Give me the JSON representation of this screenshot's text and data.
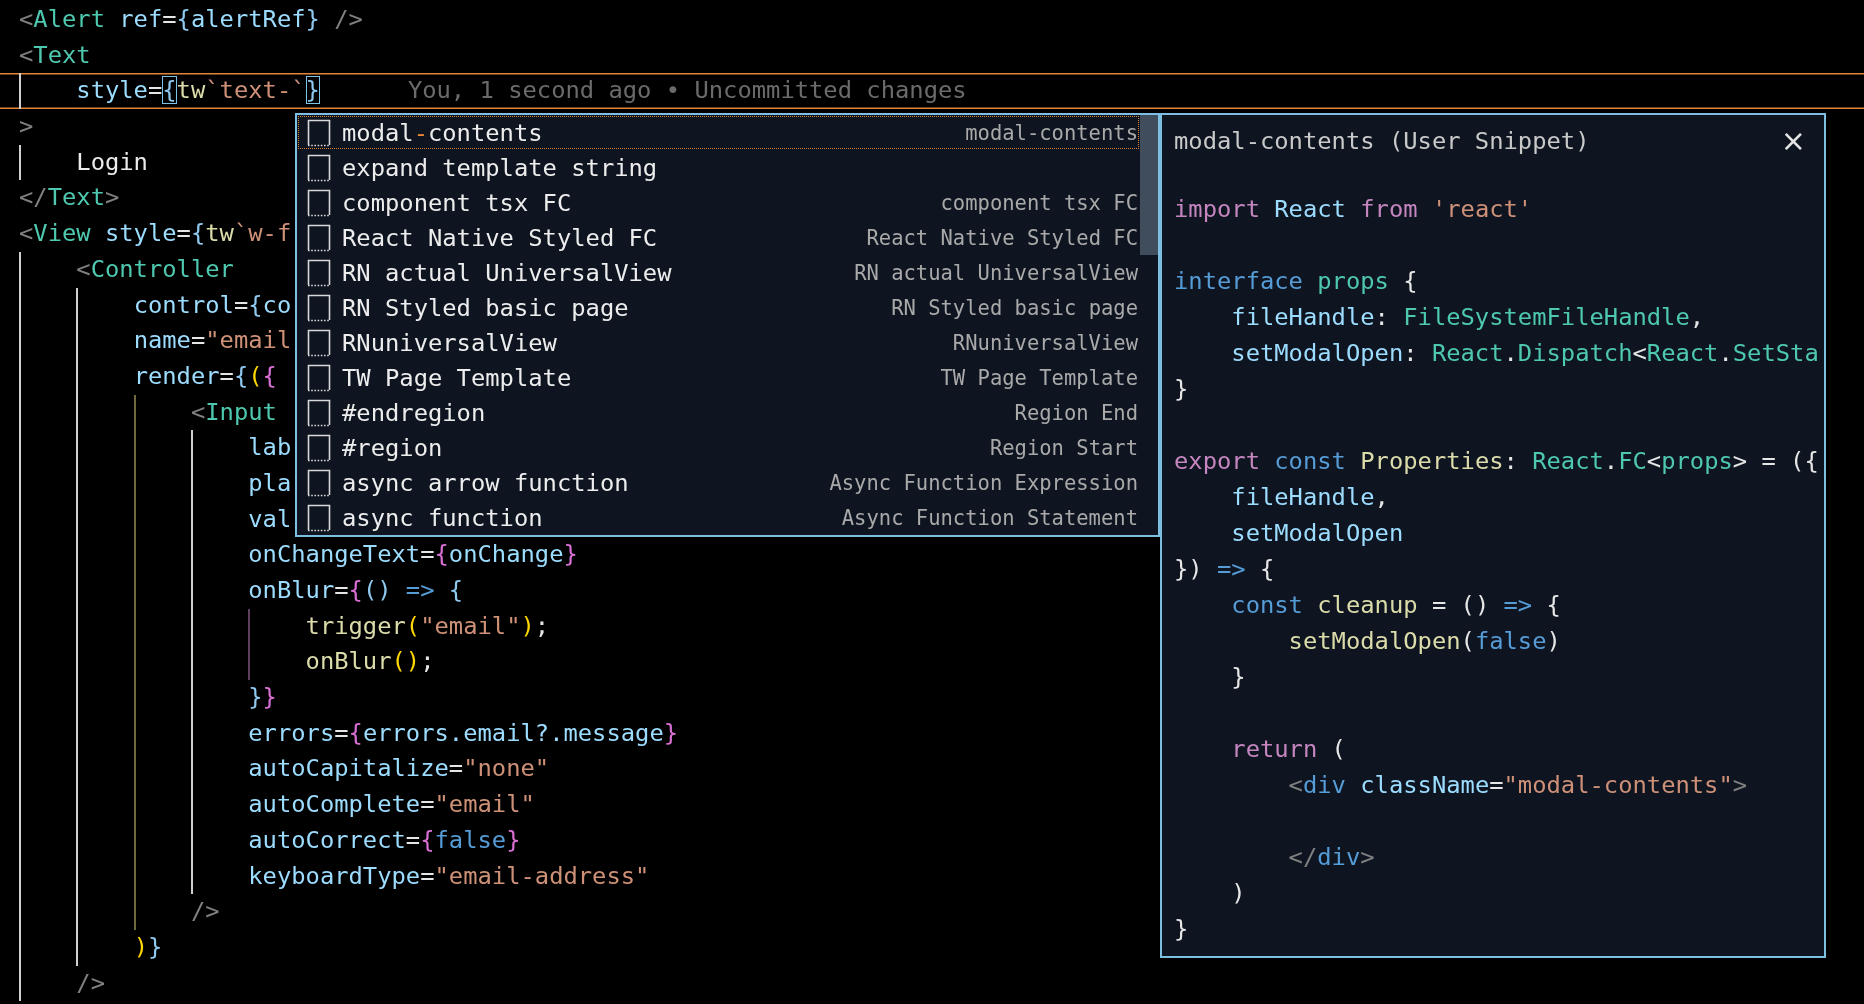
{
  "editor": {
    "lines": [
      {
        "current": false,
        "tokens": [
          {
            "t": "<",
            "kind": "p"
          },
          {
            "t": "Alert",
            "kind": "tag"
          },
          {
            "t": " ref",
            "kind": "attr"
          },
          {
            "t": "=",
            "kind": "op"
          },
          {
            "t": "{",
            "kind": "brace"
          },
          {
            "t": "alertRef",
            "kind": "var"
          },
          {
            "t": "}",
            "kind": "brace"
          },
          {
            "t": " />",
            "kind": "p"
          }
        ]
      },
      {
        "current": false,
        "tokens": [
          {
            "t": "<",
            "kind": "p"
          },
          {
            "t": "Text",
            "kind": "tag"
          }
        ]
      },
      {
        "current": true,
        "blame": "You, 1 second ago • Uncommitted changes",
        "tokens": [
          {
            "t": "    style",
            "kind": "attr"
          },
          {
            "t": "=",
            "kind": "op"
          },
          {
            "t": "{",
            "kind": "mb"
          },
          {
            "t": "tw",
            "kind": "fn"
          },
          {
            "t": "`text-`",
            "kind": "str"
          },
          {
            "t": "}",
            "kind": "mb"
          }
        ]
      },
      {
        "current": false,
        "tokens": [
          {
            "t": ">",
            "kind": "p"
          }
        ]
      },
      {
        "current": false,
        "tokens": [
          {
            "t": "    Login",
            "kind": "txt"
          }
        ]
      },
      {
        "current": false,
        "tokens": [
          {
            "t": "</",
            "kind": "p"
          },
          {
            "t": "Text",
            "kind": "tag"
          },
          {
            "t": ">",
            "kind": "p"
          }
        ]
      },
      {
        "current": false,
        "tokens": [
          {
            "t": "<",
            "kind": "p"
          },
          {
            "t": "View",
            "kind": "tag"
          },
          {
            "t": " style",
            "kind": "attr"
          },
          {
            "t": "=",
            "kind": "op"
          },
          {
            "t": "{",
            "kind": "brace"
          },
          {
            "t": "tw",
            "kind": "fn"
          },
          {
            "t": "`w-f",
            "kind": "str"
          }
        ]
      },
      {
        "current": false,
        "tokens": [
          {
            "t": "    <",
            "kind": "p"
          },
          {
            "t": "Controller",
            "kind": "tag"
          }
        ]
      },
      {
        "current": false,
        "tokens": [
          {
            "t": "        control",
            "kind": "attr"
          },
          {
            "t": "=",
            "kind": "op"
          },
          {
            "t": "{",
            "kind": "brace"
          },
          {
            "t": "co",
            "kind": "var"
          }
        ]
      },
      {
        "current": false,
        "tokens": [
          {
            "t": "        name",
            "kind": "attr"
          },
          {
            "t": "=",
            "kind": "op"
          },
          {
            "t": "\"email",
            "kind": "str"
          }
        ]
      },
      {
        "current": false,
        "tokens": [
          {
            "t": "        render",
            "kind": "attr"
          },
          {
            "t": "=",
            "kind": "op"
          },
          {
            "t": "{",
            "kind": "brace"
          },
          {
            "t": "(",
            "kind": "gold"
          },
          {
            "t": "{",
            "kind": "pink"
          }
        ]
      },
      {
        "current": false,
        "tokens": [
          {
            "t": "            <",
            "kind": "p"
          },
          {
            "t": "Input",
            "kind": "tag"
          }
        ]
      },
      {
        "current": false,
        "tokens": [
          {
            "t": "                lab",
            "kind": "attr"
          }
        ]
      },
      {
        "current": false,
        "tokens": [
          {
            "t": "                pla",
            "kind": "attr"
          }
        ]
      },
      {
        "current": false,
        "tokens": [
          {
            "t": "                val",
            "kind": "attr"
          }
        ]
      },
      {
        "current": false,
        "tokens": [
          {
            "t": "                onChangeText",
            "kind": "attr"
          },
          {
            "t": "=",
            "kind": "op"
          },
          {
            "t": "{",
            "kind": "pink"
          },
          {
            "t": "onChange",
            "kind": "var"
          },
          {
            "t": "}",
            "kind": "pink"
          }
        ]
      },
      {
        "current": false,
        "tokens": [
          {
            "t": "                onBlur",
            "kind": "attr"
          },
          {
            "t": "=",
            "kind": "op"
          },
          {
            "t": "{",
            "kind": "pink"
          },
          {
            "t": "()",
            "kind": "brace"
          },
          {
            "t": " =>",
            "kind": "kw"
          },
          {
            "t": " {",
            "kind": "brace"
          }
        ]
      },
      {
        "current": false,
        "tokens": [
          {
            "t": "                    trigger",
            "kind": "fn"
          },
          {
            "t": "(",
            "kind": "gold"
          },
          {
            "t": "\"email\"",
            "kind": "str"
          },
          {
            "t": ")",
            "kind": "gold"
          },
          {
            "t": ";",
            "kind": "op"
          }
        ]
      },
      {
        "current": false,
        "tokens": [
          {
            "t": "                    onBlur",
            "kind": "fn"
          },
          {
            "t": "()",
            "kind": "gold"
          },
          {
            "t": ";",
            "kind": "op"
          }
        ]
      },
      {
        "current": false,
        "tokens": [
          {
            "t": "                }",
            "kind": "brace"
          },
          {
            "t": "}",
            "kind": "pink"
          }
        ]
      },
      {
        "current": false,
        "tokens": [
          {
            "t": "                errors",
            "kind": "attr"
          },
          {
            "t": "=",
            "kind": "op"
          },
          {
            "t": "{",
            "kind": "pink"
          },
          {
            "t": "errors.email?.message",
            "kind": "var"
          },
          {
            "t": "}",
            "kind": "pink"
          }
        ]
      },
      {
        "current": false,
        "tokens": [
          {
            "t": "                autoCapitalize",
            "kind": "attr"
          },
          {
            "t": "=",
            "kind": "op"
          },
          {
            "t": "\"none\"",
            "kind": "str"
          }
        ]
      },
      {
        "current": false,
        "tokens": [
          {
            "t": "                autoComplete",
            "kind": "attr"
          },
          {
            "t": "=",
            "kind": "op"
          },
          {
            "t": "\"email\"",
            "kind": "str"
          }
        ]
      },
      {
        "current": false,
        "tokens": [
          {
            "t": "                autoCorrect",
            "kind": "attr"
          },
          {
            "t": "=",
            "kind": "op"
          },
          {
            "t": "{",
            "kind": "pink"
          },
          {
            "t": "false",
            "kind": "kw"
          },
          {
            "t": "}",
            "kind": "pink"
          }
        ]
      },
      {
        "current": false,
        "tokens": [
          {
            "t": "                keyboardType",
            "kind": "attr"
          },
          {
            "t": "=",
            "kind": "op"
          },
          {
            "t": "\"email-address\"",
            "kind": "str"
          }
        ]
      },
      {
        "current": false,
        "tokens": [
          {
            "t": "            />",
            "kind": "p"
          }
        ]
      },
      {
        "current": false,
        "tokens": [
          {
            "t": "        )",
            "kind": "gold"
          },
          {
            "t": "}",
            "kind": "brace"
          }
        ]
      },
      {
        "current": false,
        "tokens": [
          {
            "t": "    />",
            "kind": "p"
          }
        ]
      }
    ]
  },
  "suggest": {
    "items": [
      {
        "selected": true,
        "label_parts": [
          {
            "text": "modal",
            "match": false
          },
          {
            "text": "-",
            "match": true
          },
          {
            "text": "contents",
            "match": false
          }
        ],
        "detail": "modal-contents"
      },
      {
        "selected": false,
        "label": "expand template string"
      },
      {
        "selected": false,
        "label": "component tsx FC",
        "detail": "component tsx FC"
      },
      {
        "selected": false,
        "label": "React Native Styled FC",
        "detail": "React Native Styled FC"
      },
      {
        "selected": false,
        "label": "RN actual UniversalView",
        "detail": "RN actual UniversalView"
      },
      {
        "selected": false,
        "label": "RN Styled basic page",
        "detail": "RN Styled basic page"
      },
      {
        "selected": false,
        "label": "RNuniversalView",
        "detail": "RNuniversalView"
      },
      {
        "selected": false,
        "label": "TW Page Template",
        "detail": "TW Page Template"
      },
      {
        "selected": false,
        "label": "#endregion",
        "detail": "Region End"
      },
      {
        "selected": false,
        "label": "#region",
        "detail": "Region Start"
      },
      {
        "selected": false,
        "label": "async arrow function",
        "detail": "Async Function Expression"
      },
      {
        "selected": false,
        "label": "async function",
        "detail": "Async Function Statement"
      }
    ]
  },
  "details": {
    "title": "modal-contents (User Snippet)",
    "close": "×",
    "lines": [
      {
        "kind": "code",
        "tokens": [
          {
            "t": "import",
            "kind": "ctl"
          },
          {
            "t": " React",
            "kind": "var"
          },
          {
            "t": " from",
            "kind": "ctl"
          },
          {
            "t": " 'react'",
            "kind": "str"
          }
        ]
      },
      {
        "kind": "blank"
      },
      {
        "kind": "code",
        "tokens": [
          {
            "t": "interface",
            "kind": "kw"
          },
          {
            "t": " props",
            "kind": "type"
          },
          {
            "t": " {",
            "kind": "op"
          }
        ]
      },
      {
        "kind": "code",
        "tokens": [
          {
            "t": "    fileHandle",
            "kind": "var"
          },
          {
            "t": ": ",
            "kind": "op"
          },
          {
            "t": "FileSystemFileHandle",
            "kind": "type"
          },
          {
            "t": ",",
            "kind": "op"
          }
        ]
      },
      {
        "kind": "code",
        "tokens": [
          {
            "t": "    setModalOpen",
            "kind": "var"
          },
          {
            "t": ": ",
            "kind": "op"
          },
          {
            "t": "React",
            "kind": "type"
          },
          {
            "t": ".",
            "kind": "op"
          },
          {
            "t": "Dispatch",
            "kind": "type"
          },
          {
            "t": "<",
            "kind": "op"
          },
          {
            "t": "React",
            "kind": "type"
          },
          {
            "t": ".",
            "kind": "op"
          },
          {
            "t": "SetSta",
            "kind": "type"
          }
        ]
      },
      {
        "kind": "code",
        "tokens": [
          {
            "t": "}",
            "kind": "op"
          }
        ]
      },
      {
        "kind": "blank"
      },
      {
        "kind": "code",
        "tokens": [
          {
            "t": "export",
            "kind": "ctl"
          },
          {
            "t": " const",
            "kind": "kw"
          },
          {
            "t": " Properties",
            "kind": "fn"
          },
          {
            "t": ": ",
            "kind": "op"
          },
          {
            "t": "React",
            "kind": "type"
          },
          {
            "t": ".",
            "kind": "op"
          },
          {
            "t": "FC",
            "kind": "type"
          },
          {
            "t": "<",
            "kind": "op"
          },
          {
            "t": "props",
            "kind": "type"
          },
          {
            "t": "> = ({",
            "kind": "op"
          }
        ]
      },
      {
        "kind": "code",
        "tokens": [
          {
            "t": "    fileHandle",
            "kind": "var"
          },
          {
            "t": ",",
            "kind": "op"
          }
        ]
      },
      {
        "kind": "code",
        "tokens": [
          {
            "t": "    setModalOpen",
            "kind": "var"
          }
        ]
      },
      {
        "kind": "code",
        "tokens": [
          {
            "t": "})",
            "kind": "op"
          },
          {
            "t": " =>",
            "kind": "kw"
          },
          {
            "t": " {",
            "kind": "op"
          }
        ]
      },
      {
        "kind": "code",
        "tokens": [
          {
            "t": "    const",
            "kind": "kw"
          },
          {
            "t": " cleanup",
            "kind": "fn"
          },
          {
            "t": " = ()",
            "kind": "op"
          },
          {
            "t": " =>",
            "kind": "kw"
          },
          {
            "t": " {",
            "kind": "op"
          }
        ]
      },
      {
        "kind": "code",
        "tokens": [
          {
            "t": "        setModalOpen",
            "kind": "fn"
          },
          {
            "t": "(",
            "kind": "op"
          },
          {
            "t": "false",
            "kind": "kw"
          },
          {
            "t": ")",
            "kind": "op"
          }
        ]
      },
      {
        "kind": "code",
        "tokens": [
          {
            "t": "    }",
            "kind": "op"
          }
        ]
      },
      {
        "kind": "blank"
      },
      {
        "kind": "code",
        "tokens": [
          {
            "t": "    return",
            "kind": "ctl"
          },
          {
            "t": " (",
            "kind": "op"
          }
        ]
      },
      {
        "kind": "code",
        "tokens": [
          {
            "t": "        <",
            "kind": "p"
          },
          {
            "t": "div",
            "kind": "kw"
          },
          {
            "t": " className",
            "kind": "var"
          },
          {
            "t": "=",
            "kind": "op"
          },
          {
            "t": "\"modal-contents\"",
            "kind": "str"
          },
          {
            "t": ">",
            "kind": "p"
          }
        ]
      },
      {
        "kind": "blank"
      },
      {
        "kind": "code",
        "tokens": [
          {
            "t": "        </",
            "kind": "p"
          },
          {
            "t": "div",
            "kind": "kw"
          },
          {
            "t": ">",
            "kind": "p"
          }
        ]
      },
      {
        "kind": "code",
        "tokens": [
          {
            "t": "    )",
            "kind": "op"
          }
        ]
      },
      {
        "kind": "code",
        "tokens": [
          {
            "t": "}",
            "kind": "op"
          }
        ]
      }
    ]
  }
}
